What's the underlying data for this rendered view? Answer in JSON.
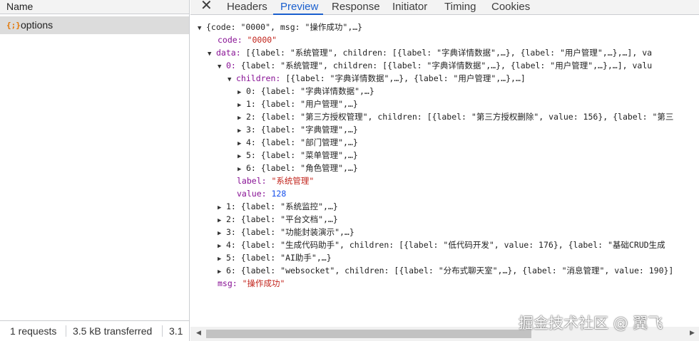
{
  "left_panel": {
    "header": "Name",
    "request": {
      "icon": "json-brace-icon",
      "icon_glyph": "{;}",
      "label": "options"
    },
    "status": {
      "requests": "1 requests",
      "transferred": "3.5 kB transferred",
      "extra": "3.1"
    }
  },
  "tabs": {
    "close_glyph": "✕",
    "items": [
      "Headers",
      "Preview",
      "Response",
      "Initiator",
      "Timing",
      "Cookies"
    ],
    "active": "Preview"
  },
  "tree": {
    "root": "{code: \"0000\", msg: \"操作成功\",…}",
    "code_key": "code: ",
    "code_val": "\"0000\"",
    "data_key": "data: ",
    "data_summary": "[{label: \"系统管理\", children: [{label: \"字典详情数据\",…}, {label: \"用户管理\",…},…], va",
    "item0_key": "0: ",
    "item0_summary": "{label: \"系统管理\", children: [{label: \"字典详情数据\",…}, {label: \"用户管理\",…},…], valu",
    "children_key": "children: ",
    "children_summary": "[{label: \"字典详情数据\",…}, {label: \"用户管理\",…},…]",
    "children": [
      "0: {label: \"字典详情数据\",…}",
      "1: {label: \"用户管理\",…}",
      "2: {label: \"第三方授权管理\", children: [{label: \"第三方授权删除\", value: 156}, {label: \"第三",
      "3: {label: \"字典管理\",…}",
      "4: {label: \"部门管理\",…}",
      "5: {label: \"菜单管理\",…}",
      "6: {label: \"角色管理\",…}"
    ],
    "label_key": "label: ",
    "label_val": "\"系统管理\"",
    "value_key": "value: ",
    "value_val": "128",
    "items": [
      "1: {label: \"系统监控\",…}",
      "2: {label: \"平台文档\",…}",
      "3: {label: \"功能封装演示\",…}",
      "4: {label: \"生成代码助手\", children: [{label: \"低代码开发\", value: 176}, {label: \"基础CRUD生成",
      "5: {label: \"AI助手\",…}",
      "6: {label: \"websocket\", children: [{label: \"分布式聊天室\",…}, {label: \"消息管理\", value: 190}]"
    ],
    "msg_key": "msg: ",
    "msg_val": "\"操作成功\""
  },
  "watermark": "掘金技术社区 @ 翼飞"
}
